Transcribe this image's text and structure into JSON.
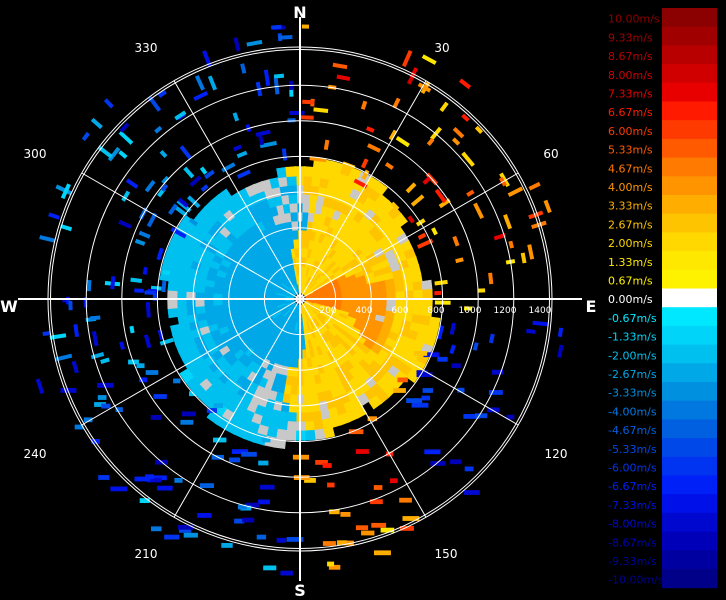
{
  "chart_data": {
    "type": "radial-velocity-ppi",
    "title": "",
    "cardinals": {
      "north": "N",
      "east": "E",
      "south": "S",
      "west": "W"
    },
    "bearing_labels": [
      "30",
      "60",
      "120",
      "150",
      "210",
      "240",
      "300",
      "330"
    ],
    "range_labels": [
      "200",
      "400",
      "600",
      "800",
      "1000",
      "1200",
      "1400"
    ],
    "range_unit": "",
    "legend": {
      "units": "m/s",
      "entries": [
        {
          "label": "10.00m/s",
          "color": "#8b0000"
        },
        {
          "label": "9.33m/s",
          "color": "#a00000"
        },
        {
          "label": "8.67m/s",
          "color": "#b80000"
        },
        {
          "label": "8.00m/s",
          "color": "#d00000"
        },
        {
          "label": "7.33m/s",
          "color": "#e80000"
        },
        {
          "label": "6.67m/s",
          "color": "#ff1a00"
        },
        {
          "label": "6.00m/s",
          "color": "#ff3a00"
        },
        {
          "label": "5.33m/s",
          "color": "#ff5a00"
        },
        {
          "label": "4.67m/s",
          "color": "#ff7a00"
        },
        {
          "label": "4.00m/s",
          "color": "#ff9400"
        },
        {
          "label": "3.33m/s",
          "color": "#ffae00"
        },
        {
          "label": "2.67m/s",
          "color": "#ffc400"
        },
        {
          "label": "2.00m/s",
          "color": "#ffd800"
        },
        {
          "label": "1.33m/s",
          "color": "#ffe800"
        },
        {
          "label": "0.67m/s",
          "color": "#fff200"
        },
        {
          "label": "0.00m/s",
          "color": "#ffffff"
        },
        {
          "label": "-0.67m/s",
          "color": "#00e8ff"
        },
        {
          "label": "-1.33m/s",
          "color": "#00d4f8"
        },
        {
          "label": "-2.00m/s",
          "color": "#00c0f0"
        },
        {
          "label": "-2.67m/s",
          "color": "#00a8e8"
        },
        {
          "label": "-3.33m/s",
          "color": "#0090e0"
        },
        {
          "label": "-4.00m/s",
          "color": "#0078e0"
        },
        {
          "label": "-4.67m/s",
          "color": "#0060e0"
        },
        {
          "label": "-5.33m/s",
          "color": "#0048e8"
        },
        {
          "label": "-6.00m/s",
          "color": "#0034f0"
        },
        {
          "label": "-6.67m/s",
          "color": "#0020f8"
        },
        {
          "label": "-7.33m/s",
          "color": "#0010e8"
        },
        {
          "label": "-8.00m/s",
          "color": "#0008d0"
        },
        {
          "label": "-8.67m/s",
          "color": "#0000b8"
        },
        {
          "label": "-9.33m/s",
          "color": "#0000a0"
        },
        {
          "label": "-10.00m/s",
          "color": "#000088"
        }
      ]
    },
    "colors": {
      "background": "#000000",
      "grid": "#ffffff",
      "no_data": "#c8c8c8",
      "west_dominant": "#2ab0e0",
      "east_dominant": "#f0a818",
      "east_core": "#e85a10"
    },
    "velocity_field": {
      "description_values": "approach (negative) to the west, recession (positive) to the east",
      "max_range": 1400,
      "west_half_velocity": -2.3,
      "east_half_velocity": 2.2,
      "east_core_velocity": 5.0
    }
  }
}
